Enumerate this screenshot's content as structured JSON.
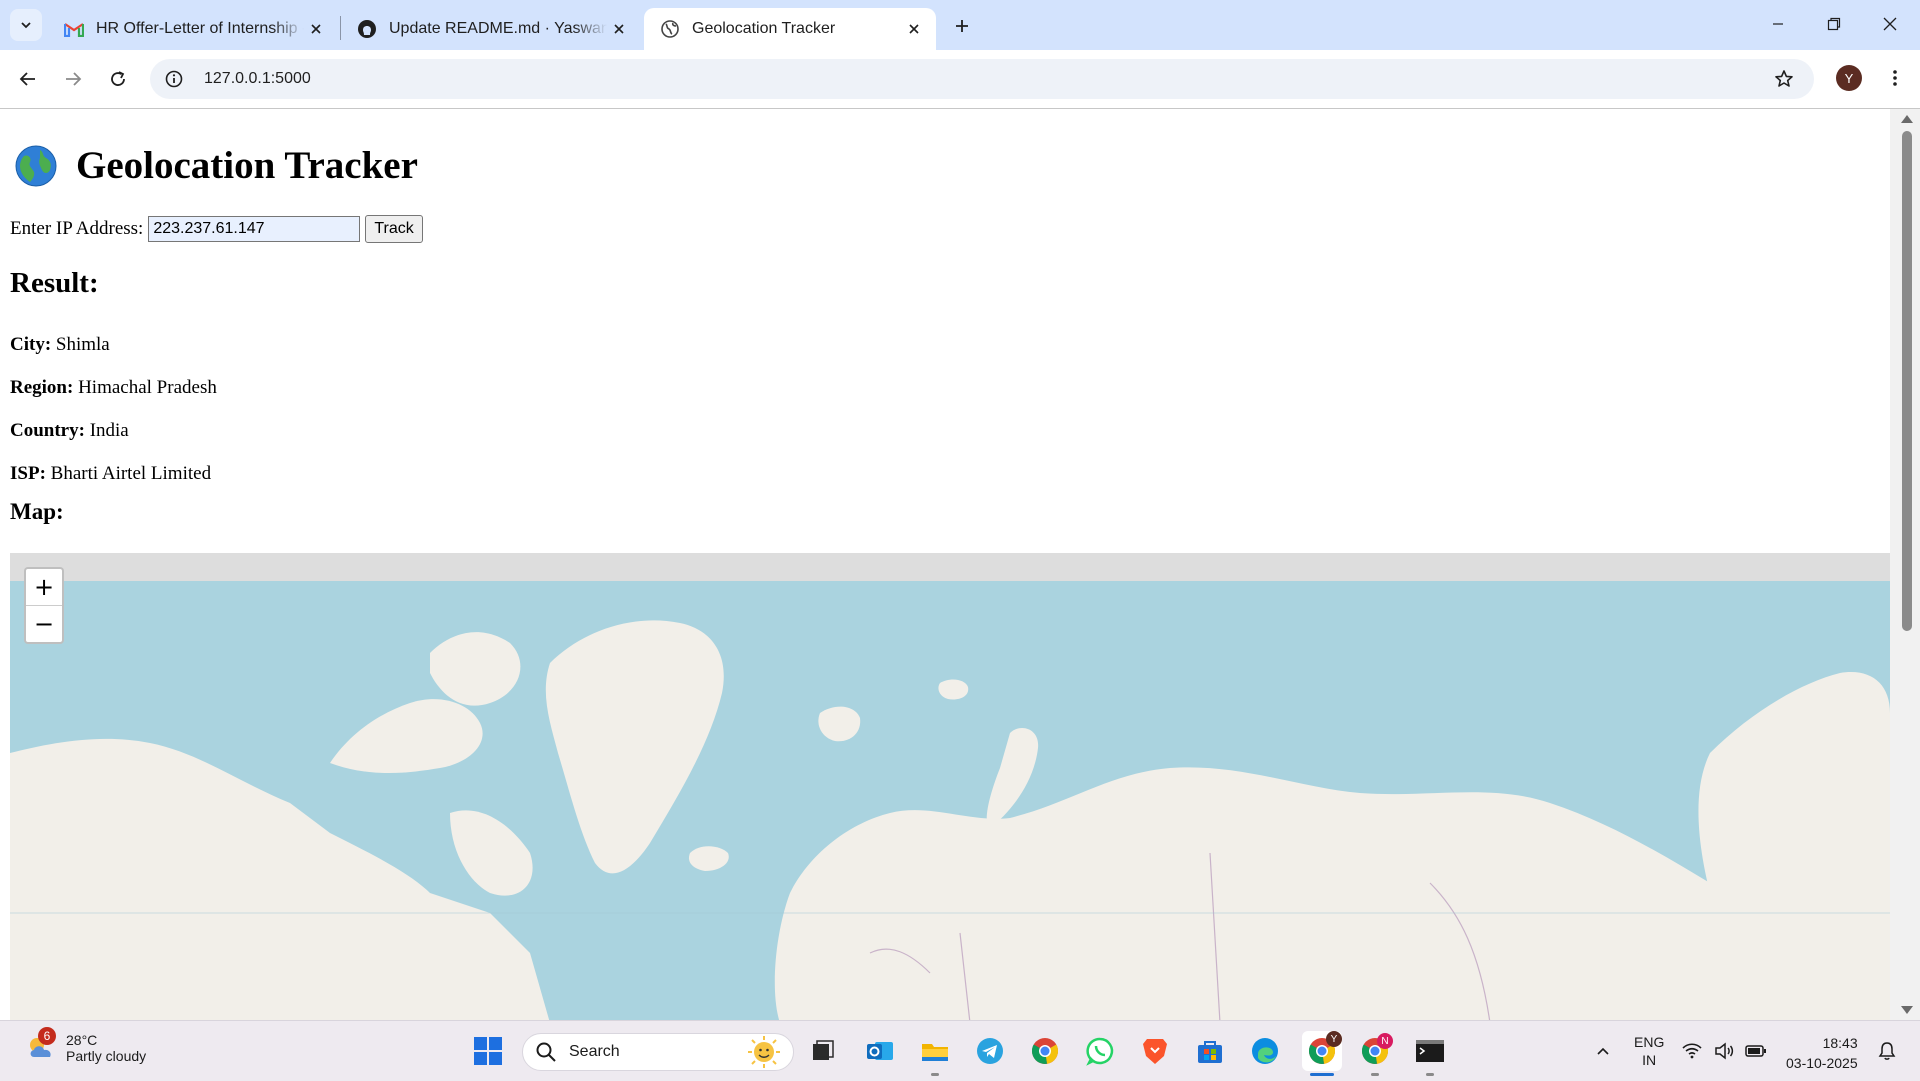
{
  "browser": {
    "tabs": [
      {
        "title": "HR Offer-Letter of Internship - y",
        "icon": "gmail-icon",
        "active": false
      },
      {
        "title": "Update README.md · Yaswanth",
        "icon": "github-icon",
        "active": false
      },
      {
        "title": "Geolocation Tracker",
        "icon": "globe-icon",
        "active": true
      }
    ],
    "url": "127.0.0.1:5000",
    "profile_initial": "Y"
  },
  "page": {
    "title": "Geolocation Tracker",
    "title_icon": "earth-globe-emoji",
    "ip_label": "Enter IP Address:",
    "ip_value": "223.237.61.147",
    "track_label": "Track",
    "result_heading": "Result:",
    "fields": [
      {
        "label": "City:",
        "value": "Shimla"
      },
      {
        "label": "Region:",
        "value": "Himachal Pradesh"
      },
      {
        "label": "Country:",
        "value": "India"
      },
      {
        "label": "ISP:",
        "value": "Bharti Airtel Limited"
      }
    ],
    "map_heading": "Map:",
    "map": {
      "zoom_in": "+",
      "zoom_out": "−",
      "ocean_color": "#aad3df",
      "land_color": "#f2efe9"
    }
  },
  "taskbar": {
    "weather": {
      "temp": "28°C",
      "condition": "Partly cloudy",
      "badge": "6"
    },
    "search_label": "Search",
    "chrome_profile_badges": [
      "Y",
      "N"
    ],
    "lang_top": "ENG",
    "lang_bottom": "IN",
    "time": "18:43",
    "date": "03-10-2025"
  }
}
